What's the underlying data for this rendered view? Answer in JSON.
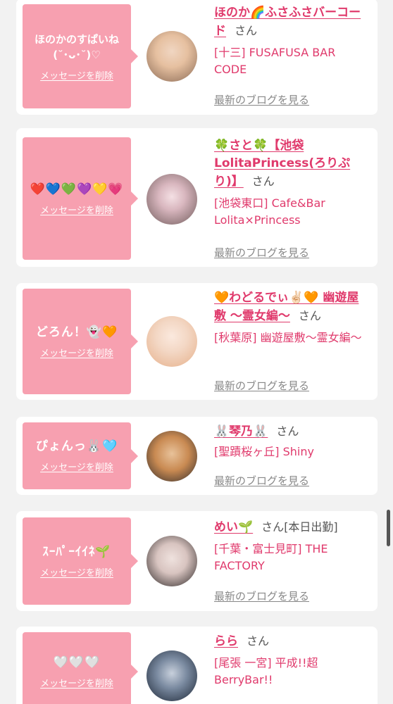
{
  "delete_label": "メッセージを削除",
  "blog_label": "最新のブログを見る",
  "san": "さん",
  "cards": [
    {
      "message": "ほのかのすぱいね\n(˘･ᴗ･˘)♡",
      "name": "ほのか🌈ふさふさバーコード",
      "status": "",
      "shop": "[十三] FUSAFUSA BAR CODE",
      "avatar_colors": [
        "#e8c9a8",
        "#8a6a55"
      ]
    },
    {
      "message": "❤️💙💚💜💛💗",
      "name": "🍀さと🍀【池袋LolitaPrincess(ろりぷり)】",
      "status": "",
      "shop": "[池袋東口] Cafe&Bar Lolita×Princess",
      "avatar_colors": [
        "#6f5a5a",
        "#d9b7bf"
      ]
    },
    {
      "message": "どろん！👻🧡",
      "name": "🧡わどるでぃ✌🏻🧡 幽遊屋敷 〜霊女編〜",
      "status": "",
      "shop": "[秋葉原] 幽遊屋敷〜霊女編〜",
      "avatar_colors": [
        "#f3d7c4",
        "#e6b08a"
      ]
    },
    {
      "message": "ぴょんっ🐰🩵",
      "name": "🐰琴乃🐰",
      "status": "",
      "shop": "[聖蹟桜ヶ丘] Shiny",
      "avatar_colors": [
        "#2e2a2a",
        "#c98a52"
      ]
    },
    {
      "message": "ｽｰﾊﾟｰｲｲﾈ🌱",
      "name": "めい🌱",
      "status": "[本日出勤]",
      "shop": "[千葉・富士見町] THE FACTORY",
      "avatar_colors": [
        "#2a2424",
        "#d8c4c0"
      ]
    },
    {
      "message": "🤍🤍🤍",
      "name": "らら",
      "status": "",
      "shop": "[尾張 一宮] 平成!!超BerryBar!!",
      "avatar_colors": [
        "#1a2433",
        "#7a8aa0"
      ]
    }
  ]
}
